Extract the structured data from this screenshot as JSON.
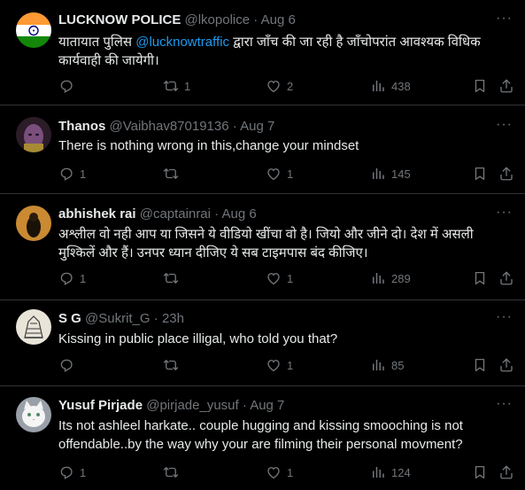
{
  "tweets": [
    {
      "name": "LUCKNOW POLICE",
      "handle": "@lkopolice",
      "sep": "·",
      "time": "Aug 6",
      "text_pre": "यातायात पुलिस ",
      "mention": "@lucknowtraffic",
      "text_post": " द्वारा जाँच की जा रही है जाँचोपरांत आवश्यक विधिक कार्यवाही की जायेगी।",
      "replies": "",
      "retweets": "1",
      "likes": "2",
      "views": "438",
      "avatar_icon": "india-flag-avatar"
    },
    {
      "name": "Thanos",
      "handle": "@Vaibhav87019136",
      "sep": "·",
      "time": "Aug 7",
      "text": "There is nothing wrong in this,change your mindset",
      "replies": "1",
      "retweets": "",
      "likes": "1",
      "views": "145",
      "avatar_icon": "thanos-avatar"
    },
    {
      "name": "abhishek rai",
      "handle": "@captainrai",
      "sep": "·",
      "time": "Aug 6",
      "text": "अश्लील वो नही आप या जिसने ये वीडियो खींचा वो है। जियो और जीने दो। देश में असली मुश्किलें और हैं। उनपर ध्यान दीजिए ये सब टाइमपास बंद कीजिए।",
      "replies": "1",
      "retweets": "",
      "likes": "1",
      "views": "289",
      "avatar_icon": "person-avatar"
    },
    {
      "name": "S G",
      "handle": "@Sukrit_G",
      "sep": "·",
      "time": "23h",
      "text": "Kissing in public place illigal, who told you that?",
      "replies": "",
      "retweets": "",
      "likes": "1",
      "views": "85",
      "avatar_icon": "sketch-avatar"
    },
    {
      "name": "Yusuf Pirjade",
      "handle": "@pirjade_yusuf",
      "sep": "·",
      "time": "Aug 7",
      "text": "Its not ashleel harkate.. couple hugging and kissing smooching is not offendable..by the way why your are filming their personal movment?",
      "replies": "1",
      "retweets": "",
      "likes": "1",
      "views": "124",
      "avatar_icon": "cat-avatar"
    }
  ],
  "more_label": "···",
  "colors": {
    "background": "#000000",
    "text": "#e7e9ea",
    "muted": "#71767b",
    "link": "#1d9bf0",
    "border": "#2f3336"
  }
}
